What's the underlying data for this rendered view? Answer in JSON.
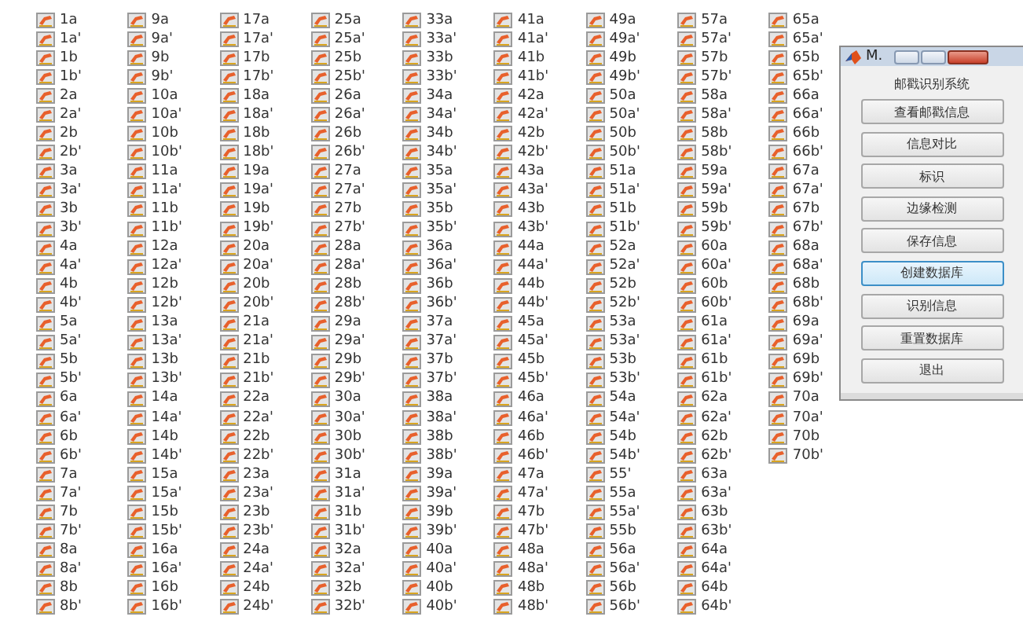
{
  "files": {
    "columns": [
      [
        "1a",
        "1a'",
        "1b",
        "1b'",
        "2a",
        "2a'",
        "2b",
        "2b'",
        "3a",
        "3a'",
        "3b",
        "3b'",
        "4a",
        "4a'",
        "4b",
        "4b'",
        "5a",
        "5a'",
        "5b",
        "5b'",
        "6a",
        "6a'",
        "6b",
        "6b'",
        "7a",
        "7a'",
        "7b",
        "7b'",
        "8a",
        "8a'",
        "8b",
        "8b'"
      ],
      [
        "9a",
        "9a'",
        "9b",
        "9b'",
        "10a",
        "10a'",
        "10b",
        "10b'",
        "11a",
        "11a'",
        "11b",
        "11b'",
        "12a",
        "12a'",
        "12b",
        "12b'",
        "13a",
        "13a'",
        "13b",
        "13b'",
        "14a",
        "14a'",
        "14b",
        "14b'",
        "15a",
        "15a'",
        "15b",
        "15b'",
        "16a",
        "16a'",
        "16b",
        "16b'"
      ],
      [
        "17a",
        "17a'",
        "17b",
        "17b'",
        "18a",
        "18a'",
        "18b",
        "18b'",
        "19a",
        "19a'",
        "19b",
        "19b'",
        "20a",
        "20a'",
        "20b",
        "20b'",
        "21a",
        "21a'",
        "21b",
        "21b'",
        "22a",
        "22a'",
        "22b",
        "22b'",
        "23a",
        "23a'",
        "23b",
        "23b'",
        "24a",
        "24a'",
        "24b",
        "24b'"
      ],
      [
        "25a",
        "25a'",
        "25b",
        "25b'",
        "26a",
        "26a'",
        "26b",
        "26b'",
        "27a",
        "27a'",
        "27b",
        "27b'",
        "28a",
        "28a'",
        "28b",
        "28b'",
        "29a",
        "29a'",
        "29b",
        "29b'",
        "30a",
        "30a'",
        "30b",
        "30b'",
        "31a",
        "31a'",
        "31b",
        "31b'",
        "32a",
        "32a'",
        "32b",
        "32b'"
      ],
      [
        "33a",
        "33a'",
        "33b",
        "33b'",
        "34a",
        "34a'",
        "34b",
        "34b'",
        "35a",
        "35a'",
        "35b",
        "35b'",
        "36a",
        "36a'",
        "36b",
        "36b'",
        "37a",
        "37a'",
        "37b",
        "37b'",
        "38a",
        "38a'",
        "38b",
        "38b'",
        "39a",
        "39a'",
        "39b",
        "39b'",
        "40a",
        "40a'",
        "40b",
        "40b'"
      ],
      [
        "41a",
        "41a'",
        "41b",
        "41b'",
        "42a",
        "42a'",
        "42b",
        "42b'",
        "43a",
        "43a'",
        "43b",
        "43b'",
        "44a",
        "44a'",
        "44b",
        "44b'",
        "45a",
        "45a'",
        "45b",
        "45b'",
        "46a",
        "46a'",
        "46b",
        "46b'",
        "47a",
        "47a'",
        "47b",
        "47b'",
        "48a",
        "48a'",
        "48b",
        "48b'"
      ],
      [
        "49a",
        "49a'",
        "49b",
        "49b'",
        "50a",
        "50a'",
        "50b",
        "50b'",
        "51a",
        "51a'",
        "51b",
        "51b'",
        "52a",
        "52a'",
        "52b",
        "52b'",
        "53a",
        "53a'",
        "53b",
        "53b'",
        "54a",
        "54a'",
        "54b",
        "54b'",
        "55'",
        "55a",
        "55a'",
        "55b",
        "56a",
        "56a'",
        "56b",
        "56b'"
      ],
      [
        "57a",
        "57a'",
        "57b",
        "57b'",
        "58a",
        "58a'",
        "58b",
        "58b'",
        "59a",
        "59a'",
        "59b",
        "59b'",
        "60a",
        "60a'",
        "60b",
        "60b'",
        "61a",
        "61a'",
        "61b",
        "61b'",
        "62a",
        "62a'",
        "62b",
        "62b'",
        "63a",
        "63a'",
        "63b",
        "63b'",
        "64a",
        "64a'",
        "64b",
        "64b'"
      ],
      [
        "65a",
        "65a'",
        "65b",
        "65b'",
        "66a",
        "66a'",
        "66b",
        "66b'",
        "67a",
        "67a'",
        "67b",
        "67b'",
        "68a",
        "68a'",
        "68b",
        "68b'",
        "69a",
        "69a'",
        "69b",
        "69b'",
        "70a",
        "70a'",
        "70b",
        "70b'"
      ]
    ]
  },
  "window": {
    "title": "M.",
    "heading": "邮戳识别系统",
    "buttons": [
      {
        "label": "查看邮戳信息",
        "selected": false
      },
      {
        "label": "信息对比",
        "selected": false
      },
      {
        "label": "标识",
        "selected": false
      },
      {
        "label": "边缘检测",
        "selected": false
      },
      {
        "label": "保存信息",
        "selected": false
      },
      {
        "label": "创建数据库",
        "selected": true
      },
      {
        "label": "识别信息",
        "selected": false
      },
      {
        "label": "重置数据库",
        "selected": false
      },
      {
        "label": "退出",
        "selected": false
      }
    ]
  }
}
